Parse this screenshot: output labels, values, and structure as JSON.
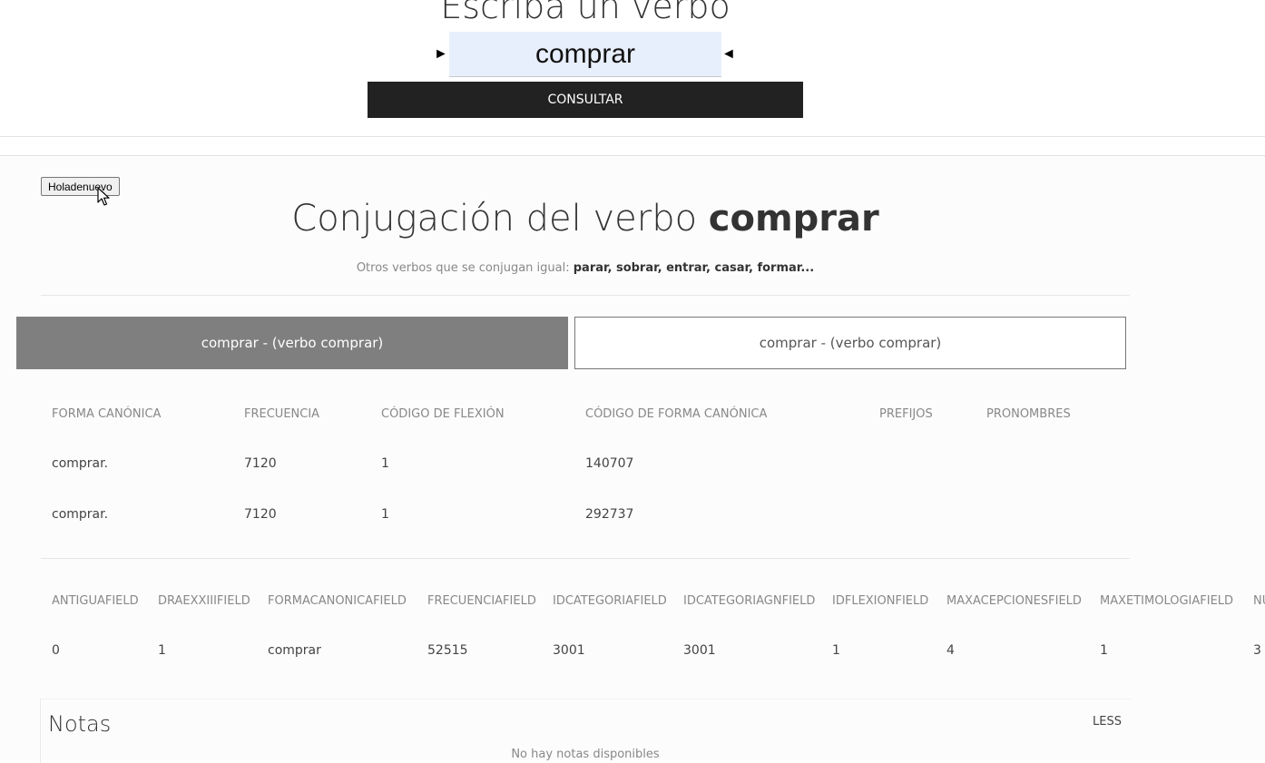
{
  "search": {
    "title": "Escriba un verbo",
    "value": "comprar",
    "arrow_left": "►",
    "arrow_right": "◄",
    "button": "CONSULTAR"
  },
  "hola_button": "Holadenuevo",
  "conjugation": {
    "title_prefix": "Conjugación del verbo ",
    "verb": "comprar",
    "otros_label": "Otros verbos que se conjugan igual:",
    "otros_list": "parar, sobrar, entrar, casar, formar..."
  },
  "tabs": [
    {
      "label": "comprar - (verbo comprar)"
    },
    {
      "label": "comprar - (verbo comprar)"
    }
  ],
  "table1": {
    "headers": [
      "FORMA CANÓNICA",
      "FRECUENCIA",
      "CÓDIGO DE FLEXIÓN",
      "CÓDIGO DE FORMA CANÓNICA",
      "PREFIJOS",
      "PRONOMBRES"
    ],
    "rows": [
      [
        "comprar.",
        "7120",
        "1",
        "140707",
        "",
        ""
      ],
      [
        "comprar.",
        "7120",
        "1",
        "292737",
        "",
        ""
      ]
    ]
  },
  "table2": {
    "headers": [
      "ANTIGUAFIELD",
      "DRAEXXIIIFIELD",
      "FORMACANONICAFIELD",
      "FRECUENCIAFIELD",
      "IDCATEGORIAFIELD",
      "IDCATEGORIAGNFIELD",
      "IDFLEXIONFIELD",
      "MAXACEPCIONESFIELD",
      "MAXETIMOLOGIAFIELD",
      "NU"
    ],
    "rows": [
      [
        "0",
        "1",
        "comprar",
        "52515",
        "3001",
        "3001",
        "1",
        "4",
        "1",
        "3"
      ]
    ]
  },
  "notas": {
    "title": "Notas",
    "less": "LESS",
    "empty": "No hay notas disponibles"
  }
}
